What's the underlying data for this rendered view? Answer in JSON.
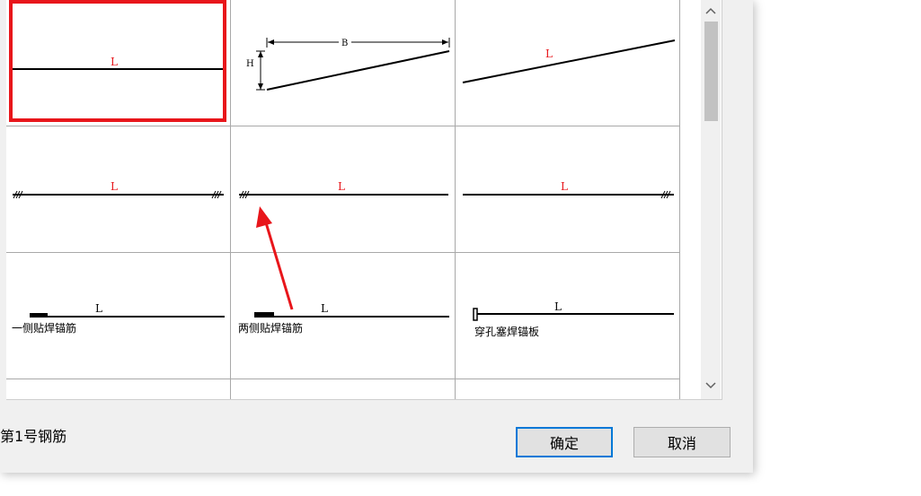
{
  "grid": {
    "cells": [
      {
        "label": "L",
        "selected": true
      },
      {
        "label_b": "B",
        "label_h": "H"
      },
      {
        "label": "L"
      },
      {
        "label": "L"
      },
      {
        "label": "L"
      },
      {
        "label": "L"
      },
      {
        "label": "L",
        "caption": "一侧贴焊锚筋"
      },
      {
        "label": "L",
        "caption": "两侧贴焊锚筋"
      },
      {
        "label": "L",
        "caption": "穿孔塞焊锚板"
      }
    ]
  },
  "status": {
    "text": "第1号钢筋"
  },
  "buttons": {
    "ok": "确定",
    "cancel": "取消"
  },
  "colors": {
    "selection": "#e8161b",
    "label_red": "#e8161b",
    "primary_border": "#0078d7"
  },
  "icons": {
    "scroll_up": "chevron-up-icon",
    "scroll_down": "chevron-down-icon"
  }
}
